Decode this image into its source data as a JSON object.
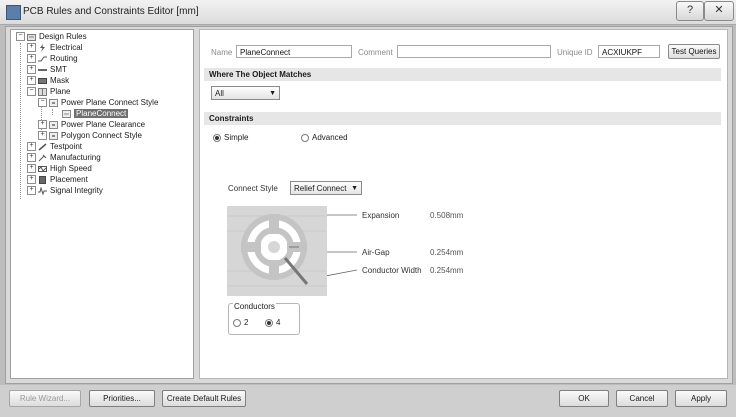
{
  "window": {
    "title": "PCB Rules and Constraints Editor [mm]",
    "help_label": "?",
    "close_label": "✕"
  },
  "tree": {
    "items": [
      {
        "label": "Design Rules",
        "expander": "−",
        "icon": "rules-folder-icon"
      },
      {
        "label": "Electrical",
        "expander": "+",
        "icon": "electrical-icon"
      },
      {
        "label": "Routing",
        "expander": "+",
        "icon": "routing-icon"
      },
      {
        "label": "SMT",
        "expander": "+",
        "icon": "smt-icon"
      },
      {
        "label": "Mask",
        "expander": "+",
        "icon": "mask-icon"
      },
      {
        "label": "Plane",
        "expander": "−",
        "icon": "plane-icon"
      },
      {
        "label": "Power Plane Connect Style",
        "expander": "−",
        "icon": "plane-rule-icon"
      },
      {
        "label": "PlaneConnect",
        "expander": "",
        "icon": "rule-icon"
      },
      {
        "label": "Power Plane Clearance",
        "expander": "+",
        "icon": "plane-rule-icon"
      },
      {
        "label": "Polygon Connect Style",
        "expander": "+",
        "icon": "plane-rule-icon"
      },
      {
        "label": "Testpoint",
        "expander": "+",
        "icon": "testpoint-icon"
      },
      {
        "label": "Manufacturing",
        "expander": "+",
        "icon": "manufacturing-icon"
      },
      {
        "label": "High Speed",
        "expander": "+",
        "icon": "high-speed-icon"
      },
      {
        "label": "Placement",
        "expander": "+",
        "icon": "placement-icon"
      },
      {
        "label": "Signal Integrity",
        "expander": "+",
        "icon": "signal-integrity-icon"
      }
    ]
  },
  "header": {
    "name_label": "Name",
    "name_value": "PlaneConnect",
    "comment_label": "Comment",
    "comment_value": "",
    "uid_label": "Unique ID",
    "uid_value": "ACXIUKPF",
    "test_queries_label": "Test Queries"
  },
  "where": {
    "title": "Where The Object Matches",
    "scope_value": "All",
    "arrow": "▼"
  },
  "constraints": {
    "title": "Constraints",
    "simple_label": "Simple",
    "advanced_label": "Advanced",
    "connect_style_label": "Connect Style",
    "connect_style_value": "Relief Connect",
    "expansion_label": "Expansion",
    "expansion_value": "0.508mm",
    "airgap_label": "Air-Gap",
    "airgap_value": "0.254mm",
    "conductor_width_label": "Conductor Width",
    "conductor_width_value": "0.254mm",
    "conductors_label": "Conductors",
    "conductors_opt1": "2",
    "conductors_opt2": "4"
  },
  "footer": {
    "rule_wizard": "Rule Wizard...",
    "priorities": "Priorities...",
    "create_defaults": "Create Default Rules",
    "ok": "OK",
    "cancel": "Cancel",
    "apply": "Apply"
  },
  "colors": {
    "selected_row": "#6f6f6f",
    "diagram_fill": "#d6d6d6"
  }
}
